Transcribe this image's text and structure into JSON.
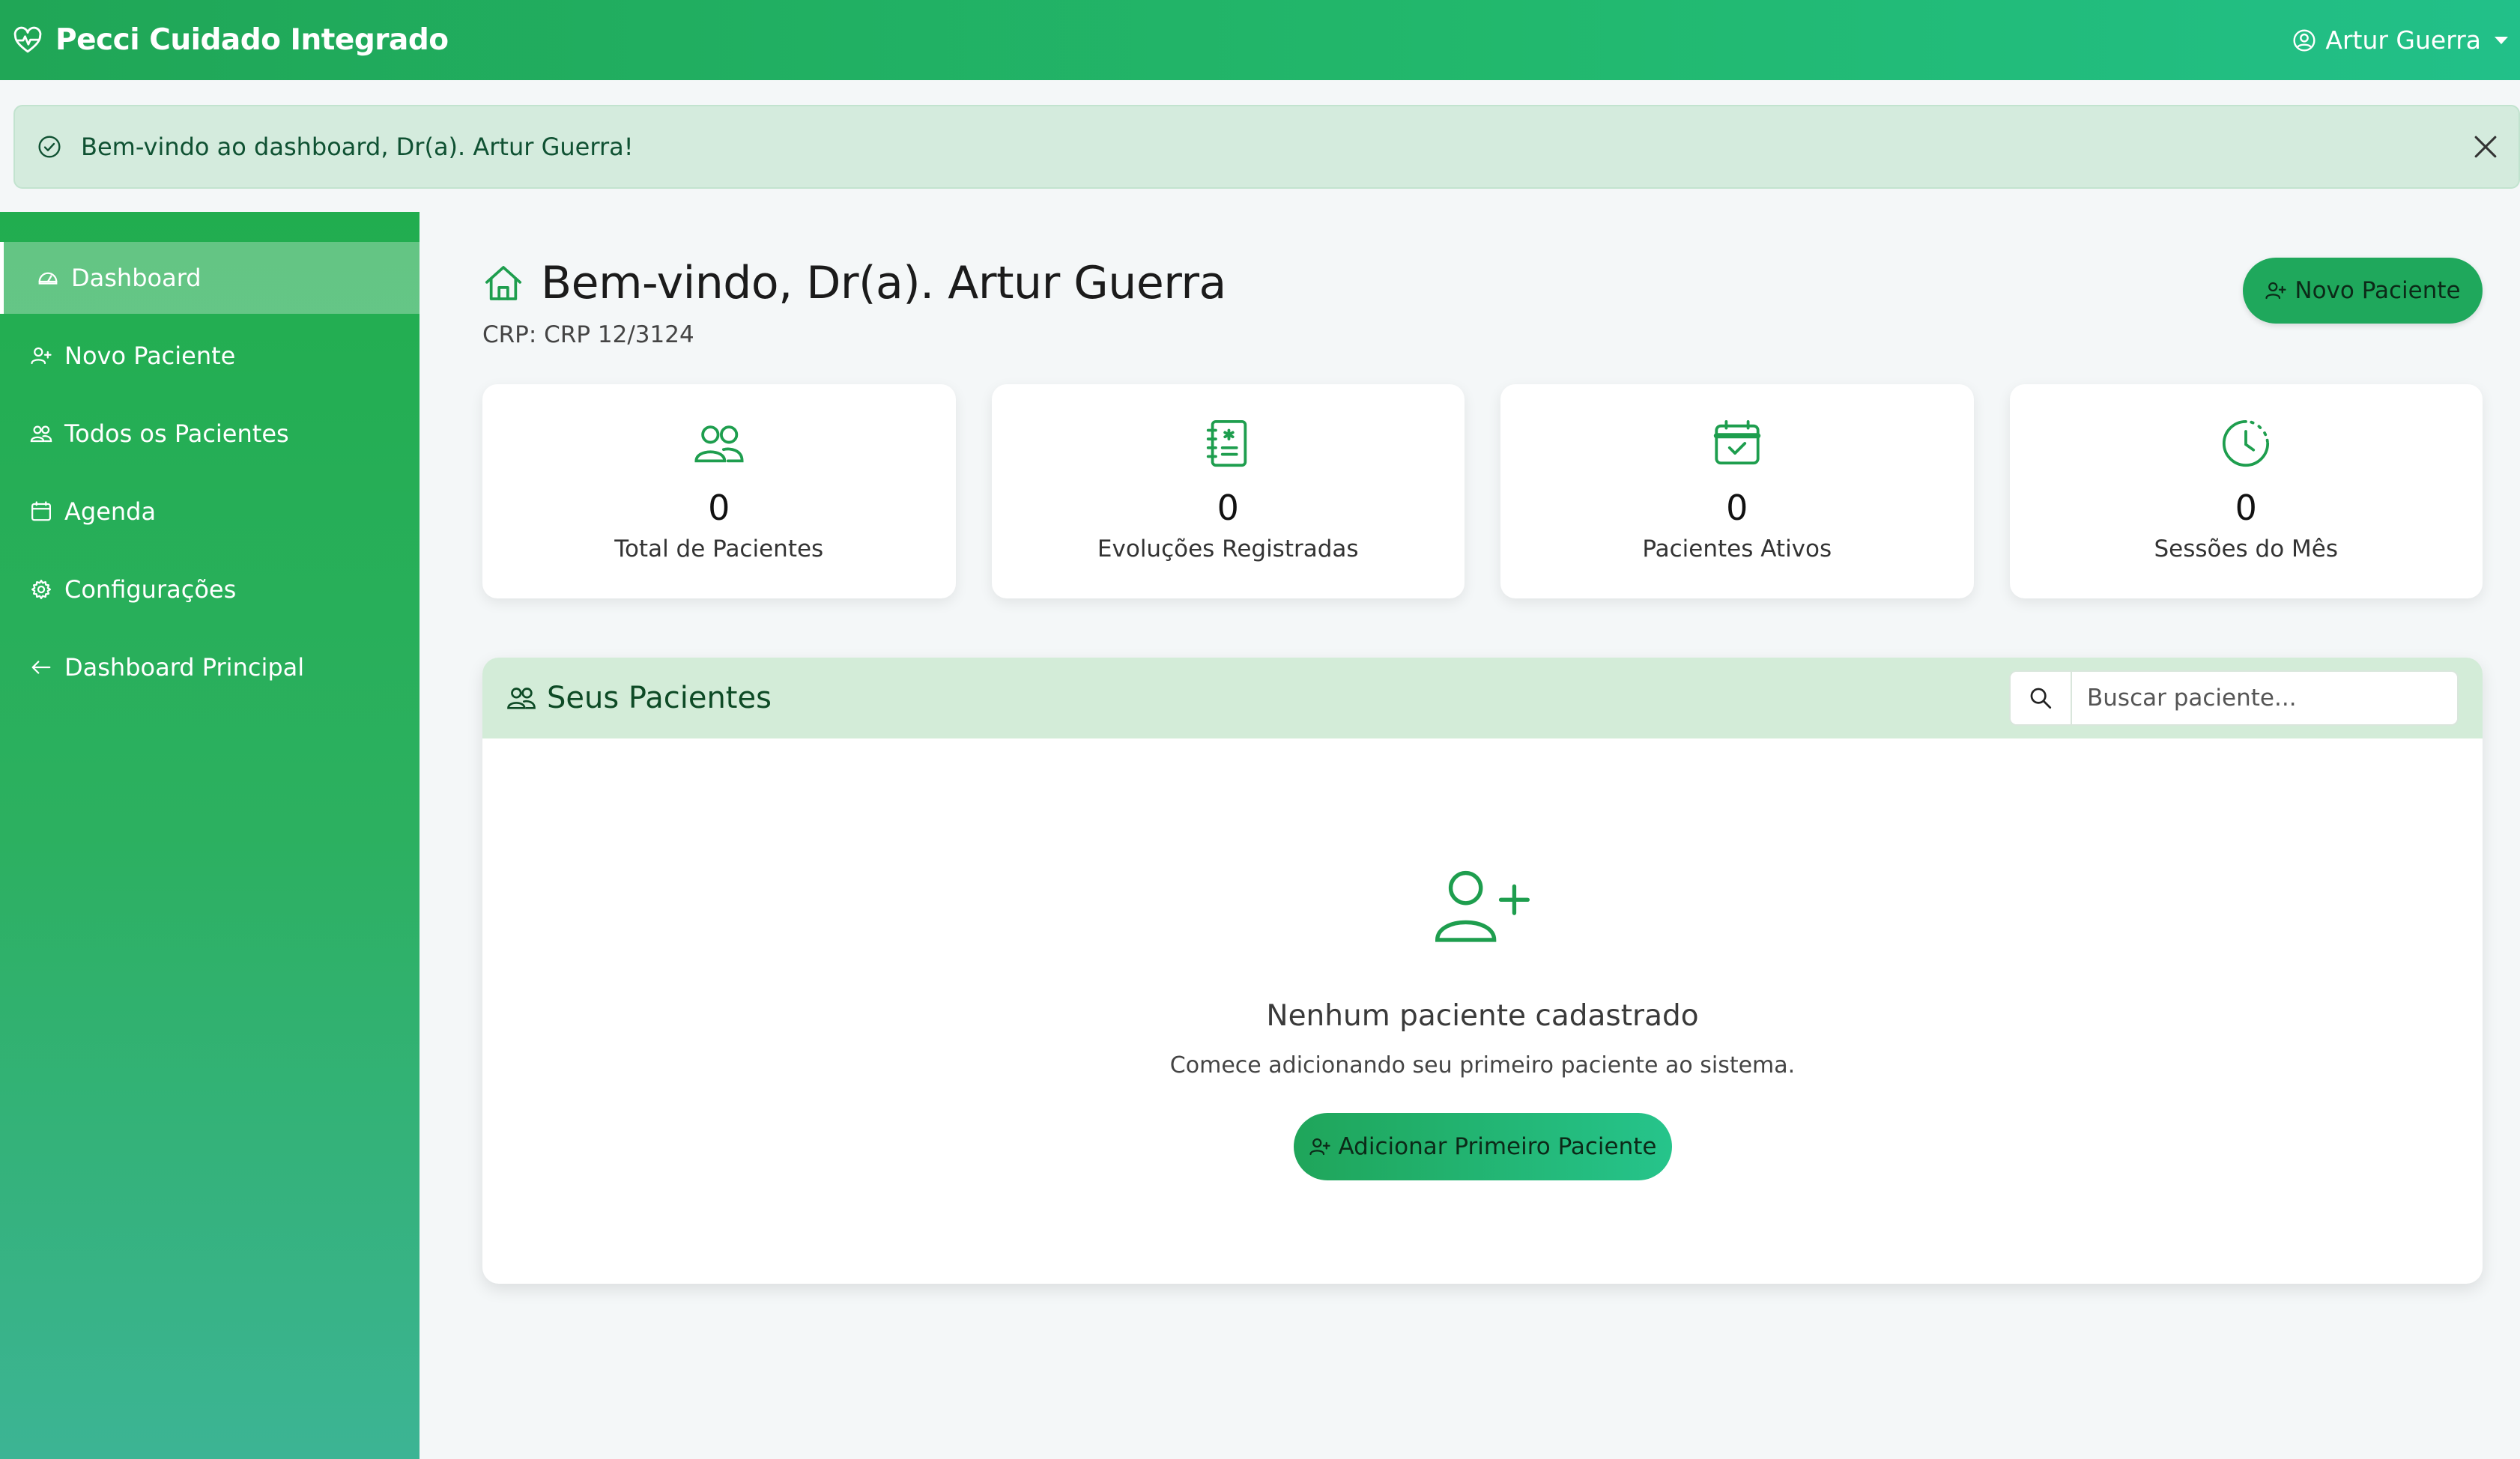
{
  "navbar": {
    "brand": "Pecci Cuidado Integrado",
    "user_name": "Artur Guerra"
  },
  "alert": {
    "message": "Bem-vindo ao dashboard, Dr(a). Artur Guerra!"
  },
  "sidebar": {
    "items": [
      {
        "label": "Dashboard",
        "icon": "dashboard-icon",
        "active": true
      },
      {
        "label": "Novo Paciente",
        "icon": "person-plus-icon"
      },
      {
        "label": "Todos os Pacientes",
        "icon": "people-icon"
      },
      {
        "label": "Agenda",
        "icon": "calendar-icon"
      },
      {
        "label": "Configurações",
        "icon": "gear-icon"
      },
      {
        "label": "Dashboard Principal",
        "icon": "arrow-left-icon"
      }
    ]
  },
  "header": {
    "title": "Bem-vindo, Dr(a). Artur Guerra",
    "crp": "CRP: CRP 12/3124",
    "new_patient_button": "Novo Paciente"
  },
  "stats": [
    {
      "value": "0",
      "label": "Total de Pacientes",
      "icon": "people-icon"
    },
    {
      "value": "0",
      "label": "Evoluções Registradas",
      "icon": "journal-medical-icon"
    },
    {
      "value": "0",
      "label": "Pacientes Ativos",
      "icon": "calendar-check-icon"
    },
    {
      "value": "0",
      "label": "Sessões do Mês",
      "icon": "clock-icon"
    }
  ],
  "patients": {
    "title": "Seus Pacientes",
    "search_placeholder": "Buscar paciente...",
    "empty_title": "Nenhum paciente cadastrado",
    "empty_subtitle": "Comece adicionando seu primeiro paciente ao sistema.",
    "add_first_button": "Adicionar Primeiro Paciente"
  },
  "colors": {
    "primary": "#22b35e",
    "primary_dark": "#1fa85c",
    "icon_green": "#1e9e4e",
    "alert_bg": "#d4ebdd",
    "section_header_bg": "#d3ecd8"
  }
}
